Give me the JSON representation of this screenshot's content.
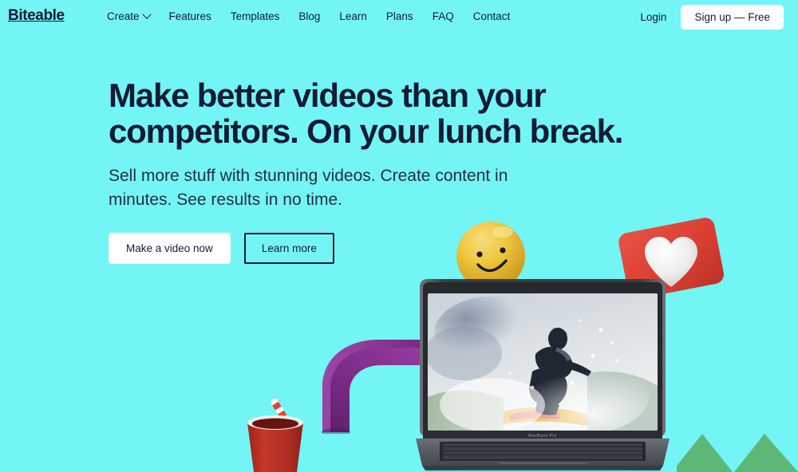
{
  "brand": {
    "name": "Biteable",
    "accent_bg": "#73F5F5",
    "ink": "#141B34",
    "white": "#FFFFFF"
  },
  "nav": {
    "items": [
      {
        "label": "Create",
        "has_dropdown": true,
        "icon": "chevron-down-icon"
      },
      {
        "label": "Features",
        "has_dropdown": false
      },
      {
        "label": "Templates",
        "has_dropdown": false
      },
      {
        "label": "Blog",
        "has_dropdown": false
      },
      {
        "label": "Learn",
        "has_dropdown": false
      },
      {
        "label": "Plans",
        "has_dropdown": false
      },
      {
        "label": "FAQ",
        "has_dropdown": false
      },
      {
        "label": "Contact",
        "has_dropdown": false
      }
    ],
    "login_label": "Login",
    "signup_label": "Sign up — Free"
  },
  "hero": {
    "headline": "Make better videos than your competitors. On your lunch break.",
    "subheadline": "Sell more stuff with stunning videos. Create content in minutes. See results in no time.",
    "primary_cta": "Make a video now",
    "secondary_cta": "Learn more"
  },
  "artwork": {
    "laptop_model_label": "MacBook Pro",
    "laptop_screen_content": "surfer riding a wave with white spray",
    "props": [
      {
        "name": "smiley-ball",
        "color": "#F2C230"
      },
      {
        "name": "heart-card",
        "color": "#E03A30",
        "heart_color": "#F2F2F2"
      },
      {
        "name": "purple-arch",
        "color": "#7B2C84"
      },
      {
        "name": "red-cup",
        "color": "#C0392B"
      },
      {
        "name": "striped-straw",
        "colors": "#E74C3C / #FFFFFF"
      },
      {
        "name": "green-chevrons",
        "color": "#5BB877"
      }
    ]
  }
}
